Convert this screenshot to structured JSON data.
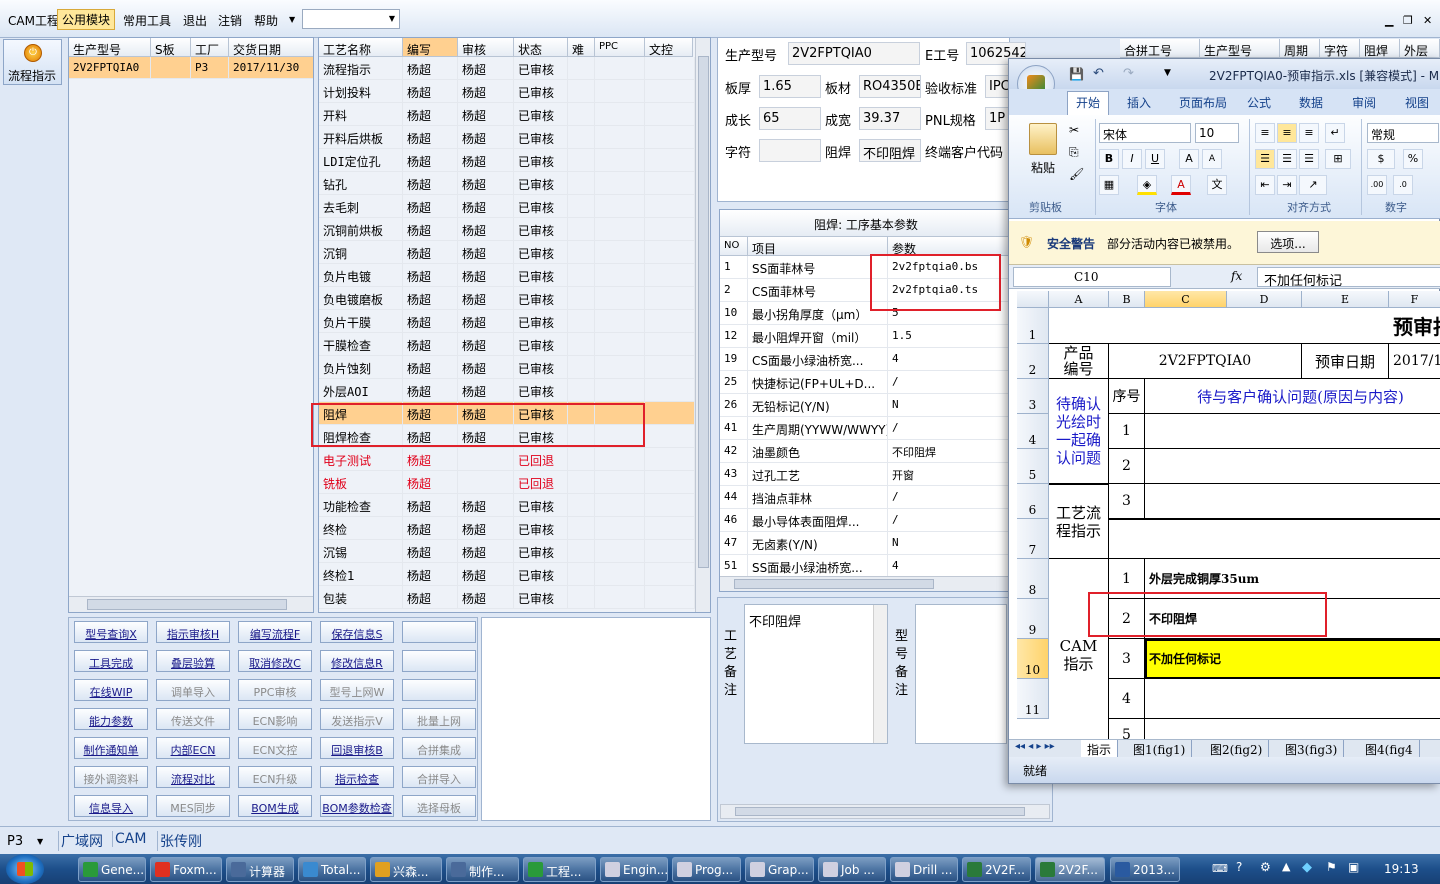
{
  "menu": {
    "items": [
      "CAM工程",
      "公用模块",
      "常用工具",
      "退出",
      "注销",
      "帮助"
    ],
    "winctl": [
      "▁",
      "❐",
      "✕"
    ]
  },
  "left_tool": {
    "label": "流程指示"
  },
  "orders": {
    "headers": [
      "生产型号",
      "S板",
      "工厂",
      "交货日期"
    ],
    "rows": [
      [
        "2V2FPTQIA0",
        "",
        "P3",
        "2017/11/30"
      ]
    ]
  },
  "process": {
    "headers": [
      "工艺名称",
      "编写",
      "审核",
      "状态",
      "难",
      "PPC",
      "文控"
    ],
    "rows": [
      [
        "流程指示",
        "杨超",
        "杨超",
        "已审核"
      ],
      [
        "计划投料",
        "杨超",
        "杨超",
        "已审核"
      ],
      [
        "开料",
        "杨超",
        "杨超",
        "已审核"
      ],
      [
        "开料后烘板",
        "杨超",
        "杨超",
        "已审核"
      ],
      [
        "LDI定位孔",
        "杨超",
        "杨超",
        "已审核"
      ],
      [
        "钻孔",
        "杨超",
        "杨超",
        "已审核"
      ],
      [
        "去毛刺",
        "杨超",
        "杨超",
        "已审核"
      ],
      [
        "沉铜前烘板",
        "杨超",
        "杨超",
        "已审核"
      ],
      [
        "沉铜",
        "杨超",
        "杨超",
        "已审核"
      ],
      [
        "负片电镀",
        "杨超",
        "杨超",
        "已审核"
      ],
      [
        "负电镀磨板",
        "杨超",
        "杨超",
        "已审核"
      ],
      [
        "负片干膜",
        "杨超",
        "杨超",
        "已审核"
      ],
      [
        "干膜检查",
        "杨超",
        "杨超",
        "已审核"
      ],
      [
        "负片蚀刻",
        "杨超",
        "杨超",
        "已审核"
      ],
      [
        "外层AOI",
        "杨超",
        "杨超",
        "已审核"
      ],
      [
        "阻焊",
        "杨超",
        "杨超",
        "已审核"
      ],
      [
        "阻焊检查",
        "杨超",
        "杨超",
        "已审核"
      ],
      [
        "电子测试",
        "杨超",
        "",
        "已回退"
      ],
      [
        "铣板",
        "杨超",
        "",
        "已回退"
      ],
      [
        "功能检查",
        "杨超",
        "杨超",
        "已审核"
      ],
      [
        "终检",
        "杨超",
        "杨超",
        "已审核"
      ],
      [
        "沉锡",
        "杨超",
        "杨超",
        "已审核"
      ],
      [
        "终检1",
        "杨超",
        "杨超",
        "已审核"
      ],
      [
        "包装",
        "杨超",
        "杨超",
        "已审核"
      ]
    ]
  },
  "buttons": [
    [
      "型号查询X",
      "指示审核H",
      "编写流程F",
      "保存信息S",
      ""
    ],
    [
      "工具完成",
      "叠层验算",
      "取消修改C",
      "修改信息R",
      ""
    ],
    [
      "在线WIP",
      "调单导入",
      "PPC审核",
      "型号上网W",
      ""
    ],
    [
      "能力参数",
      "传送文件",
      "ECN影响",
      "发送指示V",
      "批量上网"
    ],
    [
      "制作通知单",
      "内部ECN",
      "ECN文控",
      "回退审核B",
      "合拼集成"
    ],
    [
      "接外调资料",
      "流程对比",
      "ECN升级",
      "指示检查",
      "合拼导入"
    ],
    [
      "信息导入",
      "MES同步",
      "BOM生成",
      "BOM参数检查",
      "选择母板"
    ]
  ],
  "info": {
    "labels": [
      "生产型号",
      "E工号",
      "板厚",
      "板材",
      "验收标准",
      "成长",
      "成宽",
      "PNL规格",
      "字符",
      "阻焊",
      "终端客户代码"
    ],
    "values": {
      "model": "2V2FPTQIA0",
      "eno": "1062542",
      "thick": "1.65",
      "mat": "RO4350E",
      "std": "IPC",
      "len": "65",
      "wid": "39.37",
      "pnl": "1P",
      "char": "",
      "mask": "不印阻焊"
    }
  },
  "merge": {
    "headers": [
      "合拼工号",
      "生产型号",
      "周期",
      "字符",
      "阻焊",
      "外层"
    ]
  },
  "params": {
    "title": "阻焊: 工序基本参数",
    "headers": [
      "NO",
      "项目",
      "参数"
    ],
    "rows": [
      [
        "1",
        "SS面菲林号",
        "2v2fptqia0.bs"
      ],
      [
        "2",
        "CS面菲林号",
        "2v2fptqia0.ts"
      ],
      [
        "10",
        "最小拐角厚度（μm）",
        "5"
      ],
      [
        "12",
        "最小阻焊开窗（mil）",
        "1.5"
      ],
      [
        "19",
        "CS面最小绿油桥宽...",
        "4"
      ],
      [
        "25",
        "快捷标记(FP+UL+D...",
        "/"
      ],
      [
        "26",
        "无铅标记(Y/N)",
        "N"
      ],
      [
        "41",
        "生产周期(YYWW/WWYY)",
        "/"
      ],
      [
        "42",
        "油墨颜色",
        "不印阻焊"
      ],
      [
        "43",
        "过孔工艺",
        "开窗"
      ],
      [
        "44",
        "挡油点菲林",
        "/"
      ],
      [
        "46",
        "最小导体表面阻焊...",
        "/"
      ],
      [
        "47",
        "无卤素(Y/N)",
        "N"
      ],
      [
        "51",
        "SS面最小绿油桥宽...",
        "4"
      ]
    ]
  },
  "memo": {
    "craft_label": "工艺备注",
    "craft_text": "不印阻焊",
    "model_label": "型号备注"
  },
  "status": {
    "combo": "P3",
    "items": [
      "广域网",
      "CAM",
      "张传刚"
    ]
  },
  "excel": {
    "title": "2V2FPTQIA0-预审指示.xls [兼容模式] - M",
    "tabs": [
      "开始",
      "插入",
      "页面布局",
      "公式",
      "数据",
      "审阅",
      "视图"
    ],
    "groups": [
      "剪贴板",
      "字体",
      "对齐方式",
      "数字"
    ],
    "paste": "粘贴",
    "font_name": "宋体",
    "font_size": "10",
    "number_format": "常规",
    "security_title": "安全警告",
    "security_msg": "部分活动内容已被禁用。",
    "security_btn": "选项...",
    "namebox": "C10",
    "fx": "fx",
    "formula": "不加任何标记",
    "cols": [
      "A",
      "B",
      "C",
      "D",
      "E",
      "F"
    ],
    "rows": [
      "1",
      "2",
      "3",
      "4",
      "5",
      "6",
      "7",
      "8",
      "9",
      "10",
      "11"
    ],
    "cells": {
      "title": "预审指",
      "product_label": "产品编号",
      "product_val": "2V2FPTQIA0",
      "date_label": "预审日期",
      "date_val": "2017/11",
      "seq": "序号",
      "confirm_hdr": "待与客户确认问题(原因与内容)",
      "confirm_label": "待确认光绘时一起确认问题",
      "n1": "1",
      "n2": "2",
      "n3": "3",
      "flow_label": "工艺流程指示",
      "cam_label": "CAM指示",
      "c1": "1",
      "c2": "2",
      "c3": "3",
      "c4": "4",
      "c5": "5",
      "t1": "外层完成铜厚35um",
      "t2": "不印阻焊",
      "t3": "不加任何标记"
    },
    "sheets": [
      "指示",
      "图1(fig1)",
      "图2(fig2)",
      "图3(fig3)",
      "图4(fig4"
    ],
    "ready": "就绪"
  },
  "taskbar": {
    "items": [
      "Gene...",
      "Foxm...",
      "计算器",
      "Total...",
      "兴森...",
      "制作...",
      "工程...",
      "Engin...",
      "Prog...",
      "Grap...",
      "Job ...",
      "Drill ...",
      "2V2F...",
      "2V2F...",
      "2013..."
    ],
    "clock": "19:13"
  }
}
